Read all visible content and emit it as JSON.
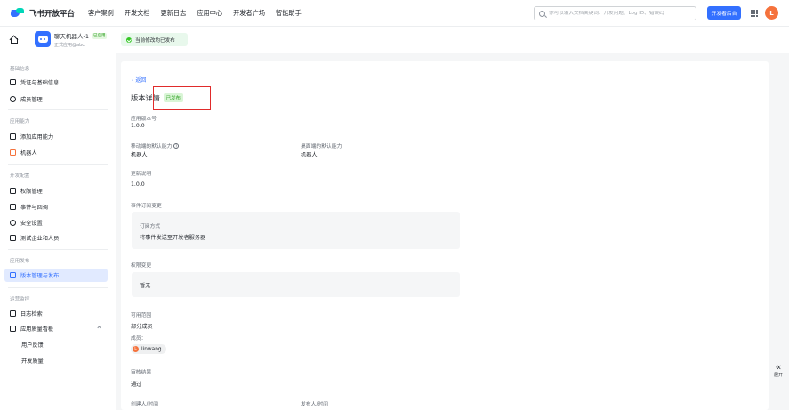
{
  "topnav": {
    "logo_text": "飞书开放平台",
    "items": [
      "客户案例",
      "开发文档",
      "更新日志",
      "应用中心",
      "开发者广场",
      "智能助手"
    ],
    "search_placeholder": "你可以输入文档关键词、开发问题、Log ID、错误码",
    "dev_button": "开发者后台",
    "avatar_letter": "L"
  },
  "subbar": {
    "app_name": "聊天机器人-1",
    "app_badge": "已启用",
    "app_sub": "正式应用@abc",
    "notice": "当前修改均已发布"
  },
  "sidebar": {
    "groups": {
      "basic": "基础信息",
      "capability": "应用能力",
      "dev_config": "开发配置",
      "release": "应用发布",
      "ops": "运营监控"
    },
    "items": {
      "credentials": "凭证与基础信息",
      "members": "成员管理",
      "add_capability": "添加应用能力",
      "bot": "机器人",
      "permissions": "权限管理",
      "events": "事件与回调",
      "security": "安全设置",
      "test_enterprise": "测试企业和人员",
      "version_release": "版本管理与发布",
      "log_search": "日志检索",
      "quality": "应用质量看板",
      "user_feedback": "用户反馈",
      "dev_quality": "开发质量"
    }
  },
  "main": {
    "back": "返回",
    "title": "版本详情",
    "status": "已发布",
    "version_label": "应用版本号",
    "version_value": "1.0.0",
    "mobile_default_label": "移动端的默认能力",
    "mobile_default_value": "机器人",
    "desktop_default_label": "桌面端的默认能力",
    "desktop_default_value": "机器人",
    "update_notes_label": "更新说明",
    "update_notes_value": "1.0.0",
    "event_sub_label": "事件订阅变更",
    "sub_method_label": "订阅方式",
    "sub_method_value": "将事件发送至开发者服务器",
    "permission_change_label": "权限变更",
    "permission_change_value": "暂无",
    "scope_label": "可用范围",
    "scope_value": "部分成员",
    "members_label": "成员：",
    "member_name": "linwang",
    "member_initial": "L",
    "review_label": "审核结果",
    "review_value": "通过",
    "creator_label": "创建人/时间",
    "publisher_label": "发布人/时间"
  },
  "expand": {
    "icon": "«",
    "label": "展开"
  },
  "colors": {
    "accent": "#3370ff",
    "success": "#2ea121",
    "highlight": "#e02b2b"
  }
}
